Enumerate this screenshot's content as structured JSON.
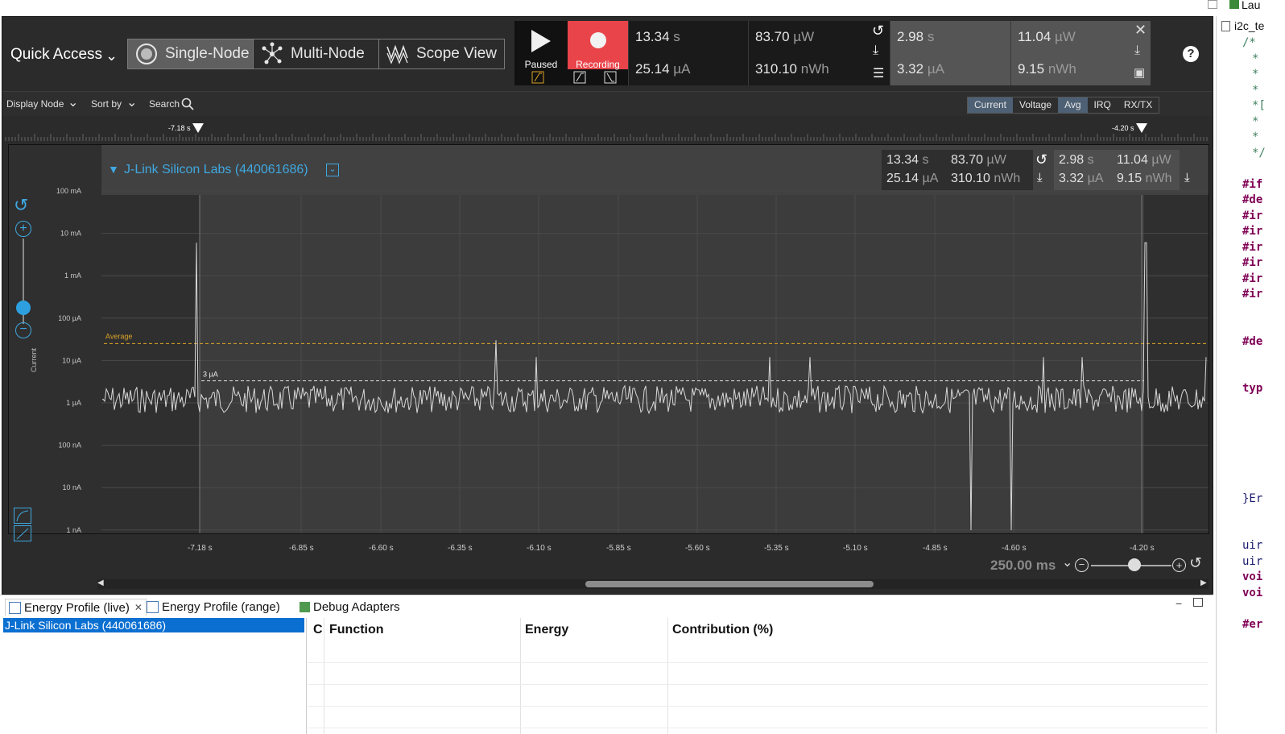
{
  "toolbar": {
    "quick_access": "Quick Access",
    "modes": [
      "Single-Node",
      "Multi-Node",
      "Scope View"
    ],
    "play_label": "Paused",
    "record_label": "Recording",
    "stats": {
      "time": "13.34",
      "time_unit": "s",
      "current": "25.14",
      "current_unit": "µA",
      "power": "83.70",
      "power_unit": "µW",
      "energy": "310.10",
      "energy_unit": "nWh"
    },
    "sel_stats": {
      "time": "2.98",
      "time_unit": "s",
      "current": "3.32",
      "current_unit": "µA",
      "power": "11.04",
      "power_unit": "µW",
      "energy": "9.15",
      "energy_unit": "nWh"
    }
  },
  "subheader": {
    "display_node": "Display Node",
    "sort_by": "Sort by",
    "search": "Search",
    "tabs": [
      "Current",
      "Voltage",
      "Avg",
      "IRQ",
      "RX/TX"
    ]
  },
  "ruler": {
    "left_marker": "-7.18 s",
    "right_marker": "-4.20 s"
  },
  "chart": {
    "node_name": "J-Link Silicon Labs (440061686)",
    "ylabel": "Current",
    "y_ticks": [
      "100 mA",
      "10 mA",
      "1 mA",
      "100 µA",
      "10 µA",
      "1 µA",
      "100 nA",
      "10 nA",
      "1 nA"
    ],
    "x_ticks": [
      "-7.18 s",
      "-6.85 s",
      "-6.60 s",
      "-6.35 s",
      "-6.10 s",
      "-5.85 s",
      "-5.60 s",
      "-5.35 s",
      "-5.10 s",
      "-4.85 s",
      "-4.60 s",
      "-4.20 s"
    ],
    "average_label": "Average",
    "sel_avg_label": "3 µA",
    "zoom": "250.00 ms",
    "colors": {
      "trace": "#d8d8d8",
      "average": "#d9a328",
      "accent": "#40a8e0"
    }
  },
  "bottom": {
    "tabs": [
      "Energy Profile (live)",
      "Energy Profile (range)",
      "Debug Adapters"
    ],
    "device": "J-Link Silicon Labs (440061686)",
    "columns": [
      "C",
      "Function",
      "Energy",
      "Contribution (%)"
    ]
  },
  "code": {
    "tab": "i2c_te",
    "lines": [
      "/*",
      "*",
      "*",
      "*",
      "*[",
      "*",
      "*",
      "*/",
      "",
      "#if",
      "#de",
      "#ir",
      "#ir",
      "#ir",
      "#ir",
      "#ir",
      "#ir",
      "",
      "",
      "#de",
      "",
      "",
      "typ",
      "",
      "",
      "",
      "",
      "",
      "",
      "}Er",
      "",
      "",
      "uir",
      "uir",
      "voi",
      "voi",
      "",
      "#er"
    ],
    "top_right": "Lau"
  }
}
